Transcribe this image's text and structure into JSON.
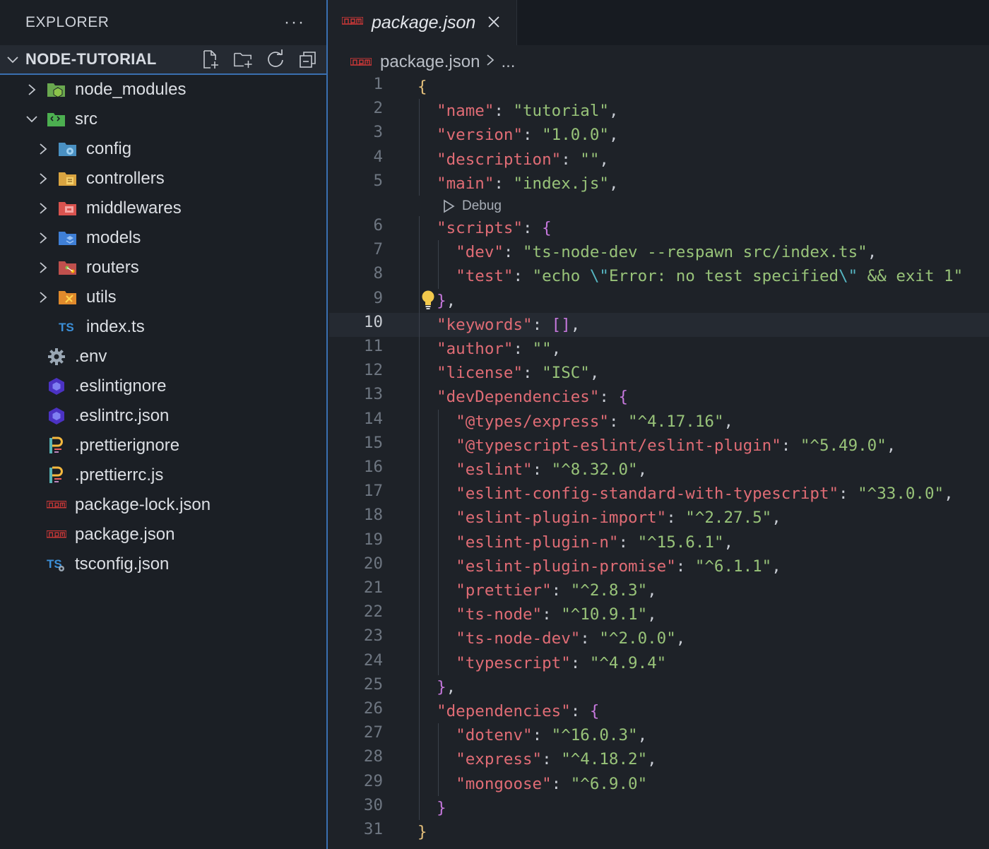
{
  "explorer": {
    "title": "EXPLORER",
    "more": "···",
    "project": "NODE-TUTORIAL",
    "actions": [
      "new-file-icon",
      "new-folder-icon",
      "refresh-icon",
      "collapse-all-icon"
    ],
    "items": [
      {
        "label": "node_modules",
        "type": "folder",
        "expanded": false,
        "icon": "node-modules-folder-icon"
      },
      {
        "label": "src",
        "type": "folder",
        "expanded": true,
        "icon": "src-folder-icon"
      },
      {
        "label": "config",
        "type": "folder",
        "expanded": false,
        "icon": "config-folder-icon"
      },
      {
        "label": "controllers",
        "type": "folder",
        "expanded": false,
        "icon": "controllers-folder-icon"
      },
      {
        "label": "middlewares",
        "type": "folder",
        "expanded": false,
        "icon": "middlewares-folder-icon"
      },
      {
        "label": "models",
        "type": "folder",
        "expanded": false,
        "icon": "models-folder-icon"
      },
      {
        "label": "routers",
        "type": "folder",
        "expanded": false,
        "icon": "routers-folder-icon"
      },
      {
        "label": "utils",
        "type": "folder",
        "expanded": false,
        "icon": "utils-folder-icon"
      },
      {
        "label": "index.ts",
        "type": "file",
        "icon": "typescript-icon"
      },
      {
        "label": ".env",
        "type": "file",
        "icon": "gear-icon"
      },
      {
        "label": ".eslintignore",
        "type": "file",
        "icon": "eslint-icon"
      },
      {
        "label": ".eslintrc.json",
        "type": "file",
        "icon": "eslint-icon"
      },
      {
        "label": ".prettierignore",
        "type": "file",
        "icon": "prettier-icon"
      },
      {
        "label": ".prettierrc.js",
        "type": "file",
        "icon": "prettier-icon"
      },
      {
        "label": "package-lock.json",
        "type": "file",
        "icon": "npm-icon"
      },
      {
        "label": "package.json",
        "type": "file",
        "icon": "npm-icon"
      },
      {
        "label": "tsconfig.json",
        "type": "file",
        "icon": "tsconfig-icon"
      }
    ]
  },
  "editor": {
    "tab_label": "package.json",
    "breadcrumb_file": "package.json",
    "breadcrumb_more": "...",
    "codelens": "Debug",
    "active_line": 10,
    "colors": {
      "key": "#e06c75",
      "string": "#98c379",
      "brace_gold": "#e5c07b",
      "brace_purple": "#c678dd"
    },
    "lines": [
      "{",
      "  \"name\": \"tutorial\",",
      "  \"version\": \"1.0.0\",",
      "  \"description\": \"\",",
      "  \"main\": \"index.js\",",
      "  \"scripts\": {",
      "    \"dev\": \"ts-node-dev --respawn src/index.ts\",",
      "    \"test\": \"echo \\\"Error: no test specified\\\" && exit 1\"",
      "  },",
      "  \"keywords\": [],",
      "  \"author\": \"\",",
      "  \"license\": \"ISC\",",
      "  \"devDependencies\": {",
      "    \"@types/express\": \"^4.17.16\",",
      "    \"@typescript-eslint/eslint-plugin\": \"^5.49.0\",",
      "    \"eslint\": \"^8.32.0\",",
      "    \"eslint-config-standard-with-typescript\": \"^33.0.0\",",
      "    \"eslint-plugin-import\": \"^2.27.5\",",
      "    \"eslint-plugin-n\": \"^15.6.1\",",
      "    \"eslint-plugin-promise\": \"^6.1.1\",",
      "    \"prettier\": \"^2.8.3\",",
      "    \"ts-node\": \"^10.9.1\",",
      "    \"ts-node-dev\": \"^2.0.0\",",
      "    \"typescript\": \"^4.9.4\"",
      "  },",
      "  \"dependencies\": {",
      "    \"dotenv\": \"^16.0.3\",",
      "    \"express\": \"^4.18.2\",",
      "    \"mongoose\": \"^6.9.0\"",
      "  }",
      "}"
    ]
  }
}
